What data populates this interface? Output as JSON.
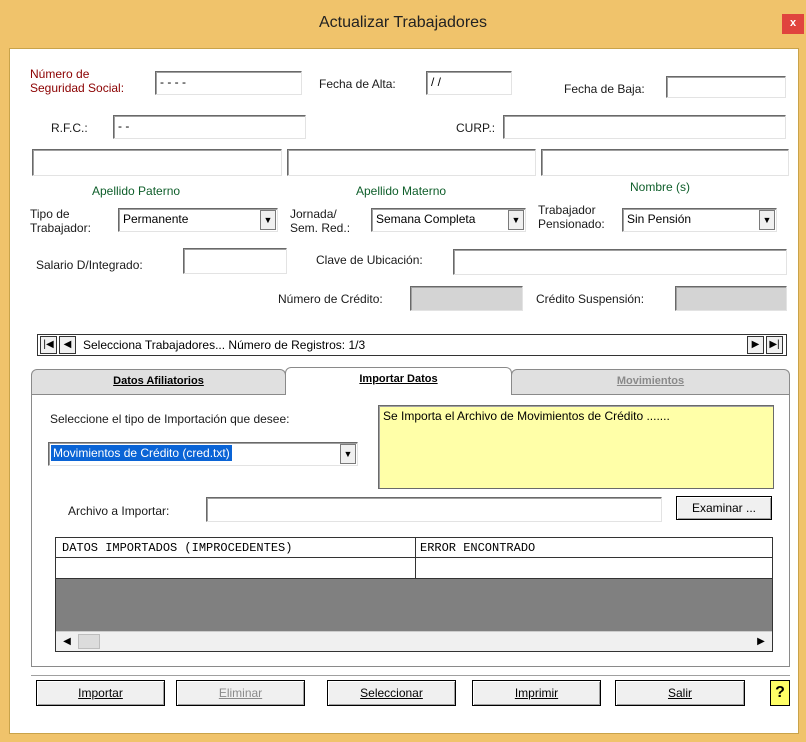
{
  "window": {
    "title": "Actualizar Trabajadores",
    "close_glyph": "x"
  },
  "form": {
    "nss_label_1": "Número de",
    "nss_label_2": "Seguridad Social:",
    "nss_value": " -  -  -  -",
    "fecha_alta_label": "Fecha de Alta:",
    "fecha_alta_value": "/ /",
    "fecha_baja_label": "Fecha de Baja:",
    "fecha_baja_value": "",
    "rfc_label": "R.F.C.:",
    "rfc_value": " -      -",
    "curp_label": "CURP.:",
    "curp_value": "",
    "apellido_paterno_value": "",
    "apellido_materno_value": "",
    "nombre_value": "",
    "apellido_paterno_label": "Apellido Paterno",
    "apellido_materno_label": "Apellido Materno",
    "nombre_label": "Nombre (s)",
    "tipo_trabajador_label_1": "Tipo de",
    "tipo_trabajador_label_2": "Trabajador:",
    "tipo_trabajador_value": "Permanente",
    "jornada_label_1": "Jornada/",
    "jornada_label_2": "Sem. Red.:",
    "jornada_value": "Semana Completa",
    "pensionado_label_1": "Trabajador",
    "pensionado_label_2": "Pensionado:",
    "pensionado_value": "Sin Pensión",
    "salario_label": "Salario D/Integrado:",
    "salario_value": "",
    "clave_ubicacion_label": "Clave de Ubicación:",
    "clave_ubicacion_value": "",
    "numero_credito_label": "Número de Crédito:",
    "credito_suspension_label": "Crédito Suspensión:"
  },
  "navbar": {
    "text": "Selecciona Trabajadores... Número de Registros:  1/3",
    "first_glyph": "|◀",
    "prev_glyph": "◀",
    "next_glyph": "▶",
    "last_glyph": "▶|"
  },
  "tabs": [
    {
      "label": "Datos Afiliatorios",
      "active": false
    },
    {
      "label": "Importar Datos",
      "active": true
    },
    {
      "label": "Movimientos",
      "active": false
    }
  ],
  "import": {
    "tipo_label": "Seleccione el tipo de Importación que desee:",
    "tipo_value": "Movimientos de Crédito (cred.txt)",
    "description": "Se Importa el Archivo de Movimientos de Crédito .......",
    "archivo_label": "Archivo a Importar:",
    "archivo_value": "",
    "examinar_label": "Examinar ..."
  },
  "grid": {
    "columns": [
      "DATOS IMPORTADOS (IMPROCEDENTES)",
      "ERROR ENCONTRADO"
    ]
  },
  "buttons": {
    "importar": "Importar",
    "eliminar": "Eliminar",
    "seleccionar": "Seleccionar",
    "imprimir": "Imprimir",
    "salir": "Salir",
    "help_glyph": "?"
  },
  "colors": {
    "frame": "#f0c36b",
    "label_red": "#8b0000",
    "label_green": "#0e5e2a",
    "description_bg": "#ffffa8",
    "selected_combo_bg": "#0a64d6"
  }
}
